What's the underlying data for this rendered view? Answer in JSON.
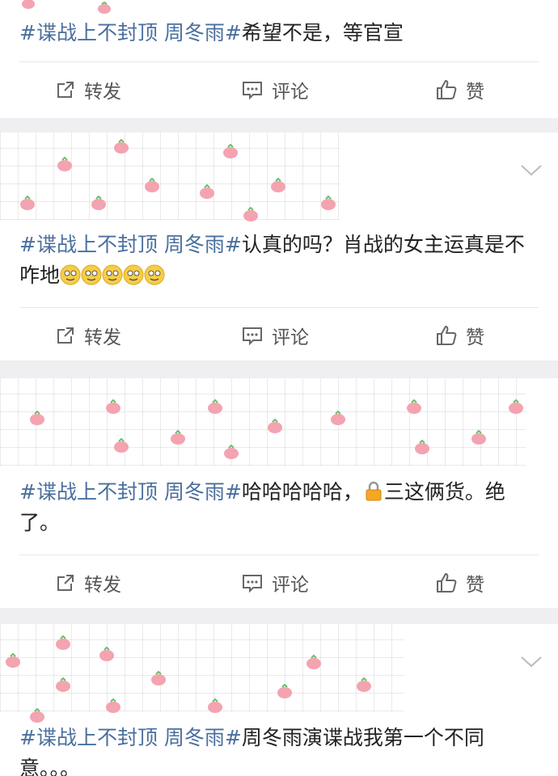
{
  "hashtag": "#谍战上不封顶 周冬雨#",
  "actions": {
    "forward": "转发",
    "comment": "评论",
    "like": "赞"
  },
  "posts": [
    {
      "text": "希望不是，等官宣"
    },
    {
      "text": "认真的吗？肖战的女主运真是不咋地"
    },
    {
      "text": "哈哈哈哈哈，",
      "text2": "三这俩货。绝了。"
    },
    {
      "text": "周冬雨演谍战我第一个不同意。。。"
    }
  ],
  "icons": [
    "forward-icon",
    "comment-icon",
    "like-icon",
    "chevron-down-icon",
    "emoji-icon",
    "lock-icon"
  ],
  "colors": {
    "hashtag": "#4a6f9e",
    "peach": "#f19aa8",
    "background": "#efeff1"
  }
}
